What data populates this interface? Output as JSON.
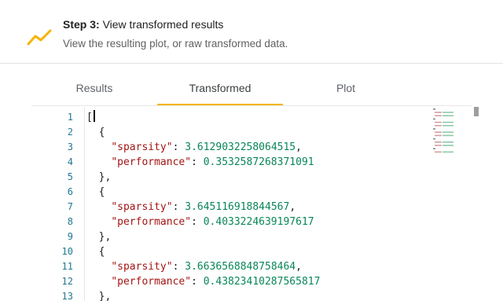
{
  "step": {
    "label": "Step 3:",
    "title": "View transformed results",
    "description": "View the resulting plot, or raw transformed data."
  },
  "tabs": [
    {
      "label": "Results"
    },
    {
      "label": "Transformed",
      "selected": true
    },
    {
      "label": "Plot"
    }
  ],
  "colors": {
    "accent": "#f4b400",
    "line_numbers": "#237893",
    "json_key": "#a31515",
    "json_number": "#098658"
  },
  "editor": {
    "line_numbers": [
      "1",
      "2",
      "3",
      "4",
      "5",
      "6",
      "7",
      "8",
      "9",
      "10",
      "11",
      "12",
      "13"
    ],
    "lines": [
      {
        "indent": "",
        "text": "["
      },
      {
        "indent": "  ",
        "text": "{"
      },
      {
        "indent": "    ",
        "key": "\"sparsity\"",
        "sep": ": ",
        "value": "3.6129032258064515",
        "tail": ","
      },
      {
        "indent": "    ",
        "key": "\"performance\"",
        "sep": ": ",
        "value": "0.3532587268371091",
        "tail": ""
      },
      {
        "indent": "  ",
        "text": "},"
      },
      {
        "indent": "  ",
        "text": "{"
      },
      {
        "indent": "    ",
        "key": "\"sparsity\"",
        "sep": ": ",
        "value": "3.645116918844567",
        "tail": ","
      },
      {
        "indent": "    ",
        "key": "\"performance\"",
        "sep": ": ",
        "value": "0.4033224639197617",
        "tail": ""
      },
      {
        "indent": "  ",
        "text": "},"
      },
      {
        "indent": "  ",
        "text": "{"
      },
      {
        "indent": "    ",
        "key": "\"sparsity\"",
        "sep": ": ",
        "value": "3.6636568848758464",
        "tail": ","
      },
      {
        "indent": "    ",
        "key": "\"performance\"",
        "sep": ": ",
        "value": "0.43823410287565817",
        "tail": ""
      },
      {
        "indent": "  ",
        "text": "},"
      }
    ]
  }
}
